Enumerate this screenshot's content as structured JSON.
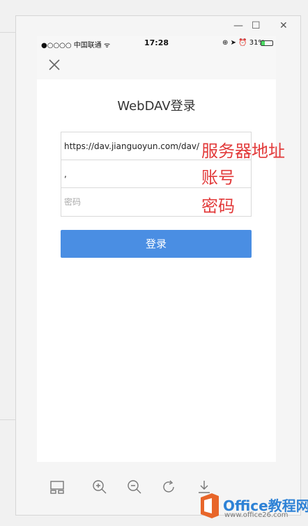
{
  "status_bar": {
    "carrier": "●○○○○ 中国联通 ᯤ",
    "time": "17:28",
    "right_indicators": "⊕ ➤ ⏰ 31%",
    "battery_percent": 31
  },
  "page": {
    "title": "WebDAV登录"
  },
  "form": {
    "server_value": "https://dav.jianguoyun.com/dav/",
    "account_value": ",",
    "password_placeholder": "密码",
    "login_label": "登录"
  },
  "annotations": {
    "server": "服务器地址",
    "account": "账号",
    "password": "密码"
  },
  "watermark": {
    "brand": "Office教程网",
    "url": "www.office26.com"
  },
  "colors": {
    "primary_button": "#4a8ee3",
    "annotation": "#e23a3a"
  }
}
